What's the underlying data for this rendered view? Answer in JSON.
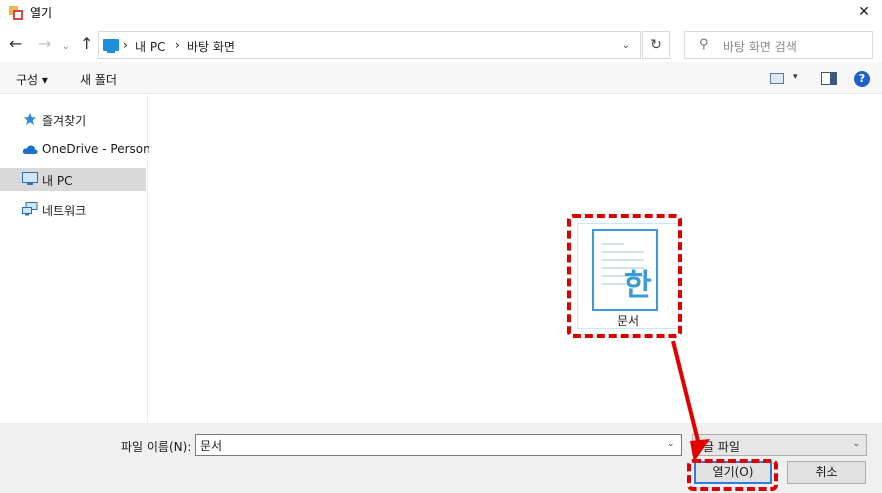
{
  "window": {
    "title": "열기",
    "close_glyph": "✕"
  },
  "address_bar": {
    "back_glyph": "←",
    "forward_glyph": "→",
    "recent_glyph": "⌄",
    "up_glyph": "↑",
    "separator": "›",
    "path": [
      "내 PC",
      "바탕 화면"
    ],
    "dropdown_glyph": "⌄",
    "refresh_glyph": "↻"
  },
  "search": {
    "icon_glyph": "⚲",
    "placeholder": "바탕 화면 검색"
  },
  "toolbar": {
    "organize_label": "구성 ▾",
    "new_folder_label": "새 폴더",
    "view_dropdown_glyph": "▾",
    "help_glyph": "?"
  },
  "sidebar": {
    "items": [
      {
        "label": "즐겨찾기",
        "icon": "star-icon",
        "selected": false
      },
      {
        "label": "OneDrive - Personal",
        "icon": "cloud-icon",
        "selected": false
      },
      {
        "label": "내 PC",
        "icon": "computer-icon",
        "selected": true
      },
      {
        "label": "네트워크",
        "icon": "network-icon",
        "selected": false
      }
    ]
  },
  "files": [
    {
      "name": "문서",
      "icon": "hangul-document-icon",
      "icon_letter": "한"
    }
  ],
  "bottom": {
    "filename_label": "파일 이름(N):",
    "filename_value": "문서",
    "filename_dropdown_glyph": "⌄",
    "filetype_value": "글 파일",
    "filetype_dropdown_glyph": "⌄",
    "open_label": "열기(O)",
    "cancel_label": "취소"
  },
  "colors": {
    "annotation": "#dd0000",
    "accent": "#2b7de0",
    "selection": "#d9d9d9",
    "file_icon": "#3a9bd6"
  }
}
